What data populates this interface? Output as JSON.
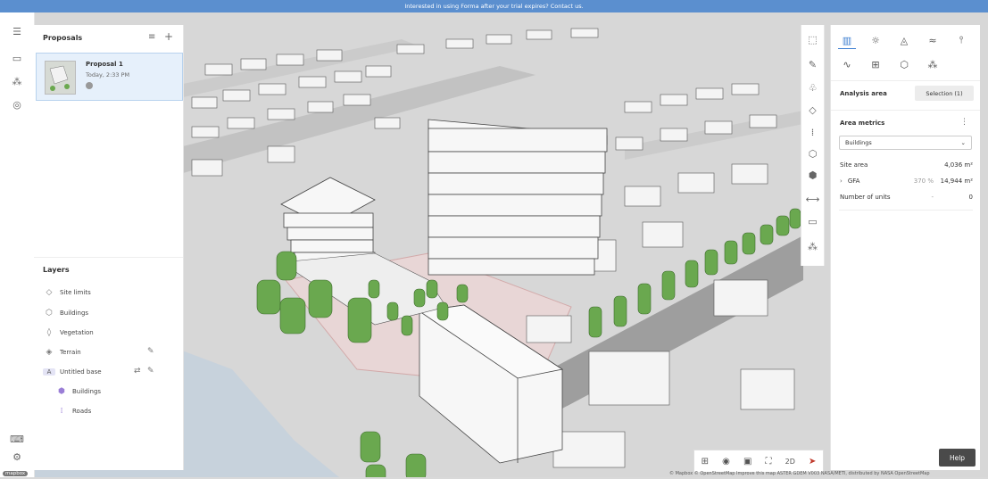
{
  "banner": {
    "text": "Interested in using Forma after your trial expires? Contact us."
  },
  "left_panel": {
    "title": "Proposals",
    "proposal": {
      "name": "Proposal 1",
      "time": "Today, 2:33 PM"
    },
    "layers_title": "Layers",
    "layers": [
      {
        "label": "Site limits",
        "icon": "site-limits-icon"
      },
      {
        "label": "Buildings",
        "icon": "buildings-icon"
      },
      {
        "label": "Vegetation",
        "icon": "vegetation-icon"
      },
      {
        "label": "Terrain",
        "icon": "terrain-icon"
      },
      {
        "label": "Untitled base",
        "icon": "base-icon",
        "badge": "A"
      },
      {
        "label": "Buildings",
        "icon": "buildings-icon",
        "indent": true
      },
      {
        "label": "Roads",
        "icon": "roads-icon",
        "indent": true
      }
    ]
  },
  "right_panel": {
    "analysis_area_label": "Analysis area",
    "selection_label": "Selection (1)",
    "area_metrics_title": "Area metrics",
    "dropdown_value": "Buildings",
    "metrics": [
      {
        "label": "Site area",
        "pct": "",
        "value": "4,036 m²"
      },
      {
        "label": "GFA",
        "pct": "370 %",
        "value": "14,944 m²",
        "expandable": true
      },
      {
        "label": "Number of units",
        "pct": "-",
        "value": "0"
      }
    ],
    "help_label": "Help"
  },
  "bottom_bar": {
    "mode_2d": "2D"
  },
  "attribution": "© Mapbox © OpenStreetMap Improve this map ASTER GDEM V003 NASA/METI, distributed by NASA OpenStreetMap",
  "mapbox_logo": "mapbox",
  "colors": {
    "banner": "#5b8fcf",
    "selected_card": "#e6f0fb",
    "tree": "#6aa84f",
    "building": "#f2f2f2"
  }
}
